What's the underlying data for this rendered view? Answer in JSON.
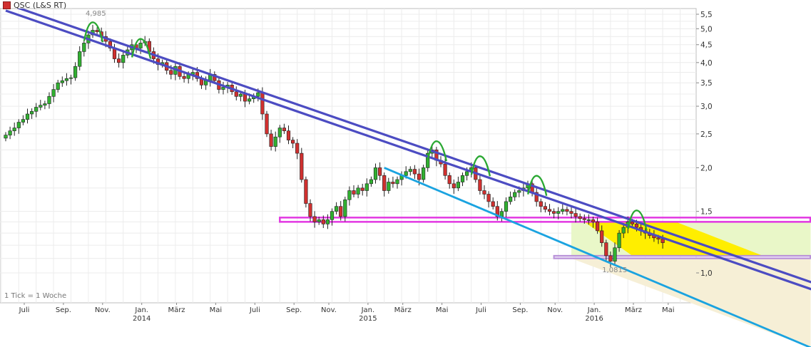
{
  "legend": {
    "label": "QSC (L&S RT)",
    "color": "#d0302f"
  },
  "note": "1 Tick = 1 Woche",
  "chart_data": {
    "type": "candlestick",
    "title": "",
    "ylim": [
      0.9,
      5.7
    ],
    "yscale": "log",
    "y_ticks": [
      {
        "v": 5.5,
        "label": "5,5"
      },
      {
        "v": 5.0,
        "label": "5,0"
      },
      {
        "v": 4.5,
        "label": "4,5"
      },
      {
        "v": 4.0,
        "label": "4,0"
      },
      {
        "v": 3.5,
        "label": "3,5"
      },
      {
        "v": 3.0,
        "label": "3,0"
      },
      {
        "v": 2.5,
        "label": "2,5"
      },
      {
        "v": 2.0,
        "label": "2,0"
      },
      {
        "v": 1.5,
        "label": "1,5"
      },
      {
        "v": 1.0,
        "label": "1,0"
      }
    ],
    "x_ticks": [
      {
        "w": 0,
        "label": "Juli"
      },
      {
        "w": 9,
        "label": "Sep."
      },
      {
        "w": 18,
        "label": "Nov."
      },
      {
        "w": 27,
        "label": "Jan.",
        "year": "2014"
      },
      {
        "w": 35,
        "label": "März"
      },
      {
        "w": 44,
        "label": "Mai"
      },
      {
        "w": 53,
        "label": "Juli"
      },
      {
        "w": 62,
        "label": "Sep."
      },
      {
        "w": 70,
        "label": "Nov."
      },
      {
        "w": 79,
        "label": "Jan.",
        "year": "2015"
      },
      {
        "w": 87,
        "label": "März"
      },
      {
        "w": 96,
        "label": "Mai"
      },
      {
        "w": 105,
        "label": "Juli"
      },
      {
        "w": 114,
        "label": "Sep."
      },
      {
        "w": 122,
        "label": "Nov."
      },
      {
        "w": 131,
        "label": "Jan.",
        "year": "2016"
      },
      {
        "w": 140,
        "label": "März"
      },
      {
        "w": 148,
        "label": "Mai"
      }
    ],
    "closes": [
      2.48,
      2.55,
      2.6,
      2.7,
      2.75,
      2.85,
      2.9,
      2.98,
      3.02,
      3.05,
      3.2,
      3.35,
      3.5,
      3.55,
      3.6,
      3.62,
      3.9,
      4.3,
      4.55,
      4.8,
      4.95,
      4.9,
      4.75,
      4.6,
      4.4,
      4.1,
      4.0,
      4.2,
      4.35,
      4.5,
      4.4,
      4.55,
      4.6,
      4.3,
      4.1,
      3.95,
      4.0,
      3.8,
      3.7,
      3.9,
      3.65,
      3.6,
      3.7,
      3.75,
      3.6,
      3.45,
      3.55,
      3.7,
      3.55,
      3.35,
      3.4,
      3.45,
      3.3,
      3.2,
      3.25,
      3.1,
      3.15,
      3.2,
      3.28,
      2.85,
      2.5,
      2.3,
      2.45,
      2.6,
      2.55,
      2.4,
      2.35,
      2.2,
      1.85,
      1.58,
      1.45,
      1.4,
      1.42,
      1.38,
      1.42,
      1.5,
      1.55,
      1.45,
      1.62,
      1.72,
      1.68,
      1.75,
      1.72,
      1.8,
      1.85,
      2.0,
      1.9,
      1.72,
      1.82,
      1.8,
      1.85,
      1.9,
      1.95,
      1.98,
      1.92,
      1.85,
      2.0,
      2.2,
      2.25,
      2.1,
      2.05,
      1.9,
      1.8,
      1.75,
      1.82,
      1.9,
      1.95,
      2.0,
      1.85,
      1.72,
      1.68,
      1.6,
      1.55,
      1.45,
      1.5,
      1.6,
      1.65,
      1.7,
      1.72,
      1.75,
      1.8,
      1.7,
      1.6,
      1.55,
      1.52,
      1.5,
      1.48,
      1.5,
      1.52,
      1.5,
      1.48,
      1.45,
      1.43,
      1.42,
      1.42,
      1.4,
      1.32,
      1.22,
      1.12,
      1.08,
      1.18,
      1.3,
      1.35,
      1.4,
      1.38,
      1.35,
      1.32,
      1.3,
      1.28,
      1.26,
      1.25,
      1.22
    ],
    "high_marker": {
      "w": 20,
      "label": "4,985"
    },
    "low_marker": {
      "w": 142,
      "label": "1,0815"
    },
    "resistance_channel": {
      "w1": 0,
      "v1": 5.9,
      "w2": 175,
      "v2": 1.04
    },
    "support_line": {
      "w1": 87,
      "v1": 2.0,
      "w2": 175,
      "v2": 0.69
    },
    "band_top": {
      "v_top": 1.44,
      "v_bottom": 1.4,
      "w1": 63,
      "w2": 175
    },
    "band_bottom": {
      "v_top": 1.12,
      "v_bottom": 1.1,
      "w1": 126,
      "w2": 175
    },
    "arcs": [
      20,
      31,
      99,
      109,
      122,
      145
    ],
    "colors": {
      "up": "#30b030",
      "down": "#d0302f",
      "channel": "#4c4cc2",
      "support": "#1aa3e0",
      "band": "#e238e2",
      "low_band": "#b890d8",
      "fill_yellow": "#ffee00",
      "fill_green": "#e9f7c8",
      "fill_cream": "#f6efd6",
      "arc": "#2aa832"
    }
  }
}
